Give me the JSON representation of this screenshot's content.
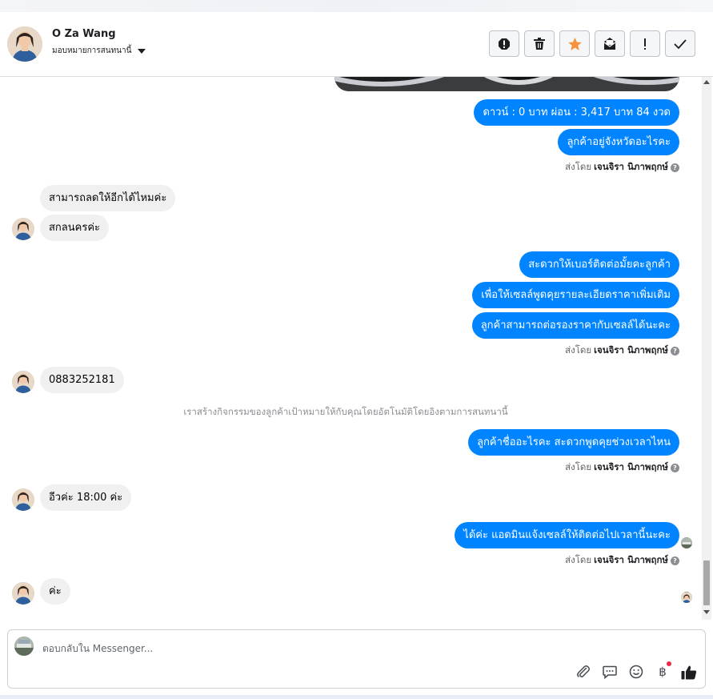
{
  "header": {
    "contact_name": "O Za Wang",
    "assign_label": "มอบหมายการสนทนานี้"
  },
  "actions": [
    {
      "name": "report-spam-icon"
    },
    {
      "name": "trash-icon"
    },
    {
      "name": "star-icon"
    },
    {
      "name": "mark-unread-icon"
    },
    {
      "name": "follow-up-icon"
    },
    {
      "name": "done-check-icon"
    }
  ],
  "thread": {
    "messages": [
      {
        "dir": "out",
        "text": "ดาวน์ : 0 บาท ผ่อน : 3,417 บาท 84 งวด"
      },
      {
        "dir": "out",
        "text": "ลูกค้าอยู่จังหวัดอะไรคะ"
      },
      {
        "dir": "in",
        "text": "สามารถลดให้อีกได้ไหมค่ะ"
      },
      {
        "dir": "in",
        "text": "สกลนครค่ะ"
      },
      {
        "dir": "out",
        "text": "สะดวกให้เบอร์ติดต่อมั้ยคะลูกค้า"
      },
      {
        "dir": "out",
        "text": "เพื่อให้เซลล์พูดคุยรายละเอียดราคาเพิ่มเติม"
      },
      {
        "dir": "out",
        "text": "ลูกค้าสามารถต่อรองราคากับเซลล์ได้นะคะ"
      },
      {
        "dir": "in",
        "text": "0883252181"
      },
      {
        "dir": "out",
        "text": "ลูกค้าชื่ออะไรคะ สะดวกพูดคุยช่วงเวลาไหน"
      },
      {
        "dir": "in",
        "text": "อีวค่ะ  18:00 ค่ะ"
      },
      {
        "dir": "out",
        "text": "ได้ค่ะ แอดมินแจ้งเซลล์ให้ติดต่อไปเวลานี้นะคะ"
      },
      {
        "dir": "in",
        "text": "ค่ะ"
      }
    ],
    "sent_by_prefix": "ส่งโดย",
    "sent_by_name": "เจนจิรา นิภาพฤกษ์",
    "system_note": "เราสร้างกิจกรรมของลูกค้าเป้าหมายให้กับคุณโดยอัตโนมัติโดยอิงตามการสนทนานี้",
    "help_glyph": "?"
  },
  "composer": {
    "placeholder": "ตอบกลับใน Messenger...",
    "tools": [
      "attachment-icon",
      "saved-replies-icon",
      "emoji-icon",
      "baht-payment-icon",
      "like-icon"
    ],
    "baht_glyph": "฿"
  },
  "colors": {
    "outgoing_bubble": "#0084ff",
    "incoming_bubble": "#f0f0f0",
    "star": "#f7923b",
    "notify_dot": "#f02849"
  }
}
